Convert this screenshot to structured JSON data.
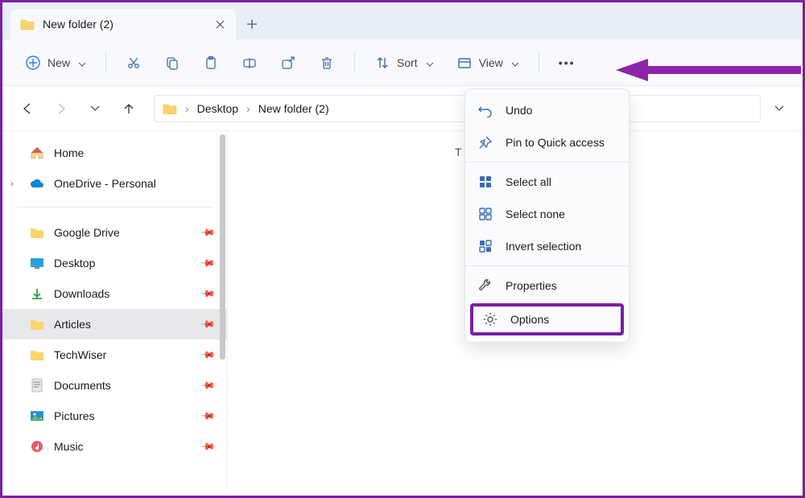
{
  "tab": {
    "title": "New folder (2)"
  },
  "toolbar": {
    "new_label": "New",
    "sort_label": "Sort",
    "view_label": "View"
  },
  "breadcrumb": {
    "level1": "Desktop",
    "level2": "New folder (2)",
    "sep": "›"
  },
  "sidebar": {
    "home": "Home",
    "onedrive": "OneDrive - Personal",
    "pinned": [
      {
        "label": "Google Drive",
        "icon": "folder"
      },
      {
        "label": "Desktop",
        "icon": "desktop"
      },
      {
        "label": "Downloads",
        "icon": "download"
      },
      {
        "label": "Articles",
        "icon": "folder",
        "selected": true
      },
      {
        "label": "TechWiser",
        "icon": "folder"
      },
      {
        "label": "Documents",
        "icon": "document"
      },
      {
        "label": "Pictures",
        "icon": "pictures"
      },
      {
        "label": "Music",
        "icon": "music"
      }
    ]
  },
  "content_peek": "T",
  "menu": {
    "undo": "Undo",
    "pin": "Pin to Quick access",
    "select_all": "Select all",
    "select_none": "Select none",
    "invert": "Invert selection",
    "properties": "Properties",
    "options": "Options"
  }
}
